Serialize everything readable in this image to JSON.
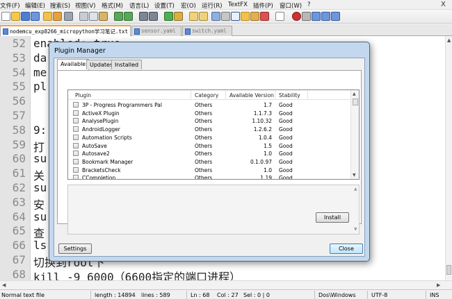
{
  "menu": [
    "文件(F)",
    "编辑(E)",
    "搜索(S)",
    "视图(V)",
    "格式(M)",
    "语言(L)",
    "设置(T)",
    "宏(O)",
    "运行(R)",
    "TextFX",
    "插件(P)",
    "窗口(W)",
    "?"
  ],
  "window_close": "X",
  "tabs": [
    {
      "label": "nodemcu_exp8266_micropython学习笔记.txt",
      "active": true
    },
    {
      "label": "sensor.yaml",
      "active": false
    },
    {
      "label": "switch.yaml",
      "active": false
    }
  ],
  "editor": {
    "lines": [
      {
        "num": "52",
        "text": "enabled: true"
      },
      {
        "num": "53",
        "text": "da"
      },
      {
        "num": "54",
        "text": "me"
      },
      {
        "num": "55",
        "text": "pl"
      },
      {
        "num": "56",
        "text": ""
      },
      {
        "num": "57",
        "text": ""
      },
      {
        "num": "58",
        "text": "9:"
      },
      {
        "num": "59",
        "text": "打"
      },
      {
        "num": "60",
        "text": "su"
      },
      {
        "num": "61",
        "text": "关"
      },
      {
        "num": "62",
        "text": "su"
      },
      {
        "num": "63",
        "text": "安"
      },
      {
        "num": "64",
        "text": "su"
      },
      {
        "num": "65",
        "text": "查"
      },
      {
        "num": "66",
        "text": "ls"
      },
      {
        "num": "67",
        "text": "切换到root下"
      },
      {
        "num": "68",
        "text": "kill -9 6000（6600指定的端口进程）"
      }
    ]
  },
  "status": {
    "file_type": "Normal text file",
    "length": "length : 14894",
    "lines": "lines : 589",
    "ln": "Ln : 68",
    "col": "Col : 27",
    "sel": "Sel : 0 | 0",
    "eol": "Dos\\Windows",
    "encoding": "UTF-8",
    "mode": "INS"
  },
  "dialog": {
    "title": "Plugin Manager",
    "tabs": [
      "Available",
      "Updates",
      "Installed"
    ],
    "columns": [
      "Plugin",
      "Category",
      "Available Version",
      "Stability"
    ],
    "plugins": [
      {
        "name": "3P - Progress Programmers Pal",
        "category": "Others",
        "version": "1.7",
        "stability": "Good"
      },
      {
        "name": "ActiveX Plugin",
        "category": "Others",
        "version": "1.1.7.3",
        "stability": "Good"
      },
      {
        "name": "AnalysePlugin",
        "category": "Others",
        "version": "1.10.32",
        "stability": "Good"
      },
      {
        "name": "AndroidLogger",
        "category": "Others",
        "version": "1.2.6.2",
        "stability": "Good"
      },
      {
        "name": "Automation Scripts",
        "category": "Others",
        "version": "1.0.4",
        "stability": "Good"
      },
      {
        "name": "AutoSave",
        "category": "Others",
        "version": "1.5",
        "stability": "Good"
      },
      {
        "name": "Autosave2",
        "category": "Others",
        "version": "1.0",
        "stability": "Good"
      },
      {
        "name": "Bookmark Manager",
        "category": "Others",
        "version": "0.1.0.97",
        "stability": "Good"
      },
      {
        "name": "BracketsCheck",
        "category": "Others",
        "version": "1.0",
        "stability": "Good"
      },
      {
        "name": "CCompletion",
        "category": "Others",
        "version": "1.19",
        "stability": "Good"
      }
    ],
    "install_label": "Install",
    "settings_label": "Settings",
    "close_label": "Close"
  },
  "colors": {
    "dialog_frame": "#c3d8ee",
    "active_tab_accent": "#f9a23b"
  }
}
